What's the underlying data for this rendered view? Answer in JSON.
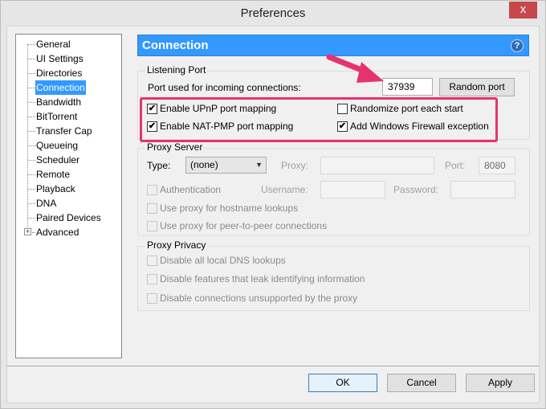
{
  "window": {
    "title": "Preferences",
    "close_label": "x"
  },
  "sidebar": {
    "items": [
      {
        "label": "General",
        "selected": false
      },
      {
        "label": "UI Settings",
        "selected": false
      },
      {
        "label": "Directories",
        "selected": false
      },
      {
        "label": "Connection",
        "selected": true
      },
      {
        "label": "Bandwidth",
        "selected": false
      },
      {
        "label": "BitTorrent",
        "selected": false
      },
      {
        "label": "Transfer Cap",
        "selected": false
      },
      {
        "label": "Queueing",
        "selected": false
      },
      {
        "label": "Scheduler",
        "selected": false
      },
      {
        "label": "Remote",
        "selected": false
      },
      {
        "label": "Playback",
        "selected": false
      },
      {
        "label": "DNA",
        "selected": false
      },
      {
        "label": "Paired Devices",
        "selected": false
      },
      {
        "label": "Advanced",
        "selected": false,
        "expandable": true
      }
    ],
    "expander_glyph": "+"
  },
  "header": {
    "title": "Connection",
    "help_glyph": "?",
    "accent_color": "#3399ff"
  },
  "listening_port": {
    "group_title": "Listening Port",
    "port_label": "Port used for incoming connections:",
    "port_value": "37939",
    "random_port_button": "Random port",
    "options": {
      "upnp": {
        "label": "Enable UPnP port mapping",
        "checked": true
      },
      "natpmp": {
        "label": "Enable NAT-PMP port mapping",
        "checked": true
      },
      "randomize": {
        "label": "Randomize port each start",
        "checked": false
      },
      "firewall": {
        "label": "Add Windows Firewall exception",
        "checked": true
      }
    },
    "check_glyph": "✔"
  },
  "proxy_server": {
    "group_title": "Proxy Server",
    "type_label": "Type:",
    "type_value": "(none)",
    "proxy_label": "Proxy:",
    "proxy_value": "",
    "port_label": "Port:",
    "port_value": "8080",
    "authentication": {
      "label": "Authentication",
      "checked": false
    },
    "username_label": "Username:",
    "username_value": "",
    "password_label": "Password:",
    "password_value": "",
    "hostname_lookups": {
      "label": "Use proxy for hostname lookups",
      "checked": false
    },
    "peer_connections": {
      "label": "Use proxy for peer-to-peer connections",
      "checked": false
    }
  },
  "proxy_privacy": {
    "group_title": "Proxy Privacy",
    "dns": {
      "label": "Disable all local DNS lookups",
      "checked": false
    },
    "leak": {
      "label": "Disable features that leak identifying information",
      "checked": false
    },
    "unsupported": {
      "label": "Disable connections unsupported by the proxy",
      "checked": false
    }
  },
  "footer": {
    "ok_label": "OK",
    "cancel_label": "Cancel",
    "apply_label": "Apply"
  },
  "annotation": {
    "arrow_color": "#e6336e",
    "highlight_color": "#e6336e"
  }
}
